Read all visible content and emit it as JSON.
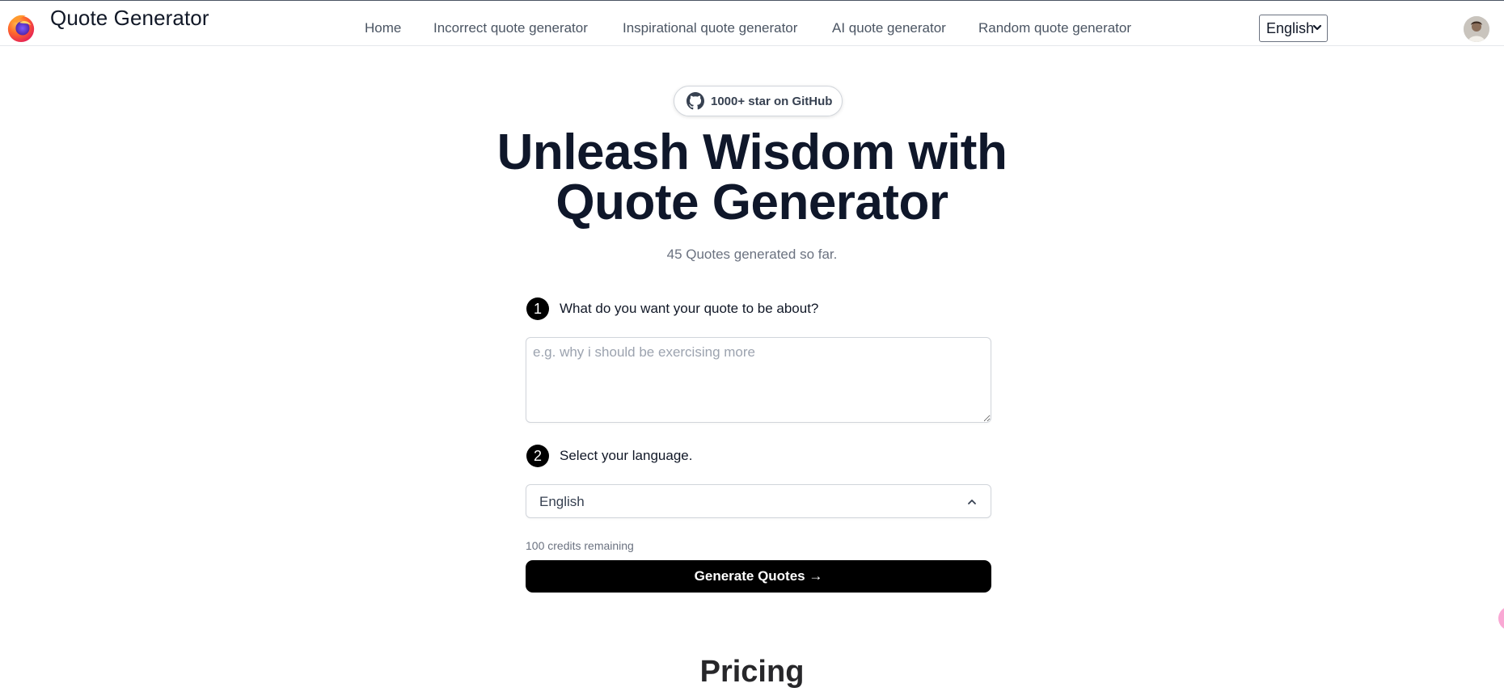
{
  "header": {
    "app_name": "Quote Generator",
    "nav": [
      {
        "label": "Home"
      },
      {
        "label": "Incorrect quote generator"
      },
      {
        "label": "Inspirational quote generator"
      },
      {
        "label": "AI quote generator"
      },
      {
        "label": "Random quote generator"
      }
    ],
    "language_select": {
      "value": "English"
    },
    "icons": {
      "logo": "firefox-logo-icon",
      "avatar": "user-avatar"
    }
  },
  "hero": {
    "github_badge": "1000+ star on GitHub",
    "title_line1": "Unleash Wisdom with",
    "title_line2": "Quote Generator",
    "counter": "45 Quotes generated so far."
  },
  "form": {
    "step1": {
      "number": "1",
      "label": "What do you want your quote to be about?"
    },
    "topic_input": {
      "value": "",
      "placeholder": "e.g. why i should be exercising more"
    },
    "step2": {
      "number": "2",
      "label": "Select your language."
    },
    "language_dropdown": {
      "value": "English"
    },
    "credits": "100 credits remaining",
    "generate_button": "Generate Quotes →"
  },
  "pricing": {
    "heading": "Pricing"
  },
  "colors": {
    "primary_button": "#000000",
    "title": "#0f172a",
    "muted_text": "#6b7280",
    "nav_text": "#4b5563"
  }
}
